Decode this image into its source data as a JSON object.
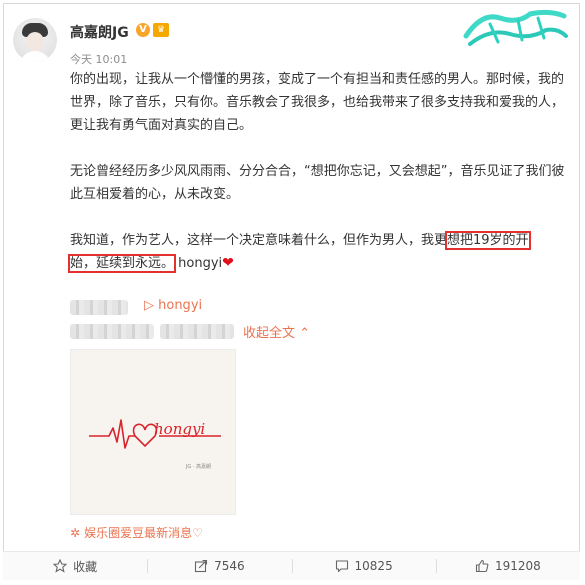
{
  "user": {
    "name": "高嘉朗JG",
    "verified_mark": "V",
    "time": "今天 10:01"
  },
  "post": {
    "para1": "你的出现，让我从一个懵懂的男孩，变成了一个有担当和责任感的男人。那时候，我的世界，除了音乐，只有你。音乐教会了我很多，也给我带来了很多支持我和爱我的人，更让我有勇气面对真实的自己。",
    "para2": "无论曾经经历多少风风雨雨、分分合合，“想把你忘记，又会想起”，音乐见证了我们彼此互相爱着的心，从未改变。",
    "para3_a": "我知道，作为艺人，这样一个决定意味着什么，但作为男人，我更",
    "para3_hl1": "想把19岁的开",
    "para3_hl2": "始，延续到永远。",
    "para3_tail": "hongyi"
  },
  "extras": {
    "link_text": "▷ hongyi",
    "collapse_text": "收起全文 ⌃",
    "image_word": "hongyi",
    "tagline": "娱乐圈爱豆最新消息♡"
  },
  "footer": {
    "favorite": "收藏",
    "share": "7546",
    "comment": "10825",
    "like": "191208"
  },
  "colors": {
    "link": "#eb7350",
    "highlight_border": "#e3312f",
    "heart": "#e0111b"
  }
}
